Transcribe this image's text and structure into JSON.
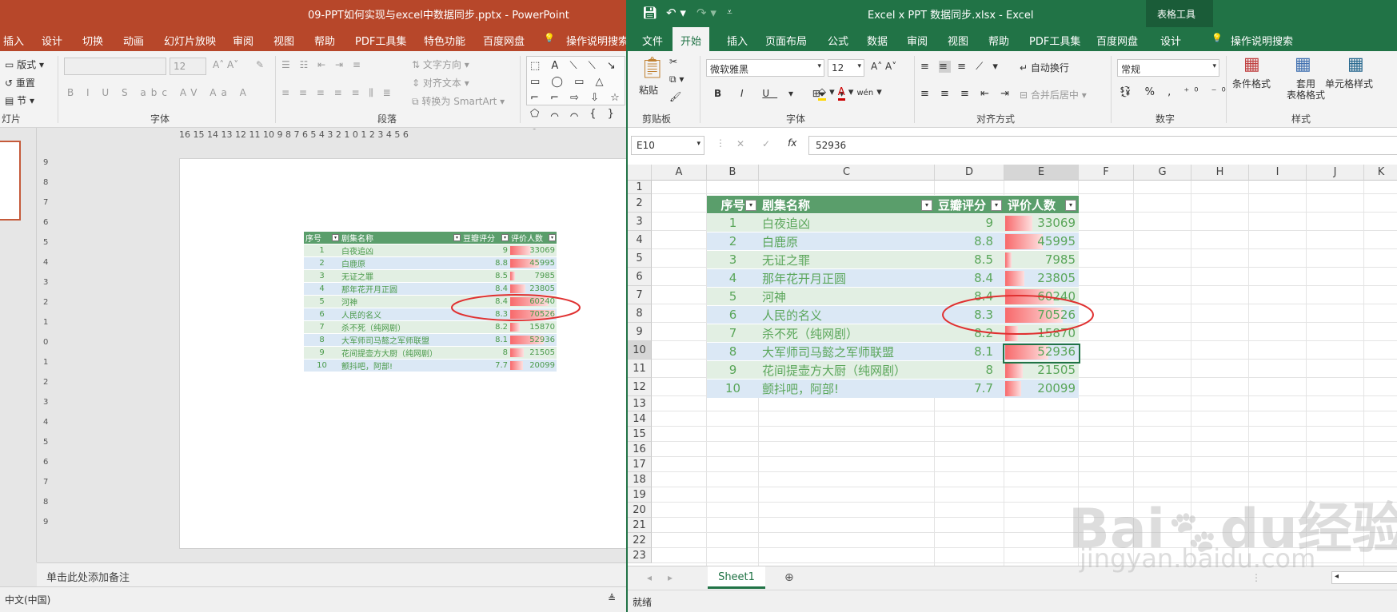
{
  "ppt": {
    "title": "09-PPT如何实现与excel中数据同步.pptx  -  PowerPoint",
    "tabs": [
      "插入",
      "设计",
      "切换",
      "动画",
      "幻灯片放映",
      "审阅",
      "视图",
      "帮助",
      "PDF工具集",
      "特色功能",
      "百度网盘",
      "操作说明搜索"
    ],
    "ribbon": {
      "slide_group": {
        "layout": "版式",
        "reset": "重置",
        "section": "节",
        "label": "灯片"
      },
      "font_group": {
        "size": "12",
        "label": "字体"
      },
      "para_group": {
        "text_dir": "文字方向",
        "align_text": "对齐文本",
        "smartart": "转换为 SmartArt",
        "label": "段落"
      }
    },
    "ruler_h": "16 15 14 13 12 11 10 9 8 7 6 5 4 3 2 1 0 1 2 3 4 5 6",
    "ruler_v": [
      "9",
      "8",
      "7",
      "6",
      "5",
      "4",
      "3",
      "2",
      "1",
      "0",
      "1",
      "2",
      "3",
      "4",
      "5",
      "6",
      "7",
      "8",
      "9"
    ],
    "notes_placeholder": "单击此处添加备注",
    "status_lang": "中文(中国)"
  },
  "excel": {
    "title": "Excel x PPT 数据同步.xlsx  -  Excel",
    "tool_context": "表格工具",
    "tabs": [
      "文件",
      "开始",
      "插入",
      "页面布局",
      "公式",
      "数据",
      "审阅",
      "视图",
      "帮助",
      "PDF工具集",
      "百度网盘",
      "设计",
      "操作说明搜索"
    ],
    "ribbon": {
      "paste": "粘贴",
      "clipboard": "剪贴板",
      "font_name": "微软雅黑",
      "font_size": "12",
      "font_label": "字体",
      "wrap": "自动换行",
      "merge": "合并后居中",
      "align_label": "对齐方式",
      "number_format": "常规",
      "number_label": "数字",
      "cond_format": "条件格式",
      "table_format_1": "套用",
      "table_format_2": "表格格式",
      "cell_style": "单元格样式",
      "style_label": "样式"
    },
    "name_box": "E10",
    "formula": "52936",
    "columns": [
      "A",
      "B",
      "C",
      "D",
      "E",
      "F",
      "G",
      "H",
      "I",
      "J",
      "K"
    ],
    "rows": [
      "1",
      "2",
      "3",
      "4",
      "5",
      "6",
      "7",
      "8",
      "9",
      "10",
      "11",
      "12",
      "13",
      "14",
      "15",
      "16",
      "17",
      "18",
      "19",
      "20",
      "21",
      "22",
      "23"
    ],
    "sheet_tab": "Sheet1",
    "status": "就绪"
  },
  "table": {
    "headers": [
      "序号",
      "剧集名称",
      "豆瓣评分",
      "评价人数"
    ],
    "rows": [
      {
        "no": "1",
        "name": "白夜追凶",
        "score": "9",
        "votes": "33069",
        "frac": 0.47
      },
      {
        "no": "2",
        "name": "白鹿原",
        "score": "8.8",
        "votes": "45995",
        "frac": 0.65
      },
      {
        "no": "3",
        "name": "无证之罪",
        "score": "8.5",
        "votes": "7985",
        "frac": 0.11
      },
      {
        "no": "4",
        "name": "那年花开月正圆",
        "score": "8.4",
        "votes": "23805",
        "frac": 0.34
      },
      {
        "no": "5",
        "name": "河神",
        "score": "8.4",
        "votes": "60240",
        "frac": 0.85
      },
      {
        "no": "6",
        "name": "人民的名义",
        "score": "8.3",
        "votes": "70526",
        "frac": 1.0
      },
      {
        "no": "7",
        "name": "杀不死（纯网剧）",
        "score": "8.2",
        "votes": "15870",
        "frac": 0.22
      },
      {
        "no": "8",
        "name": "大军师司马懿之军师联盟",
        "score": "8.1",
        "votes": "52936",
        "frac": 0.75
      },
      {
        "no": "9",
        "name": "花间提壶方大厨（纯网剧）",
        "score": "8",
        "votes": "21505",
        "frac": 0.3
      },
      {
        "no": "10",
        "name": "颤抖吧，阿部!",
        "score": "7.7",
        "votes": "20099",
        "frac": 0.28
      }
    ]
  },
  "watermark": {
    "brand": "Bai",
    "mid": "du",
    "cn": "经验",
    "url": "jingyan.baidu.com"
  },
  "colors": {
    "ppt_accent": "#b7472a",
    "excel_accent": "#217346",
    "table_header": "#5a9e6b",
    "highlight_circle": "#e03030"
  }
}
